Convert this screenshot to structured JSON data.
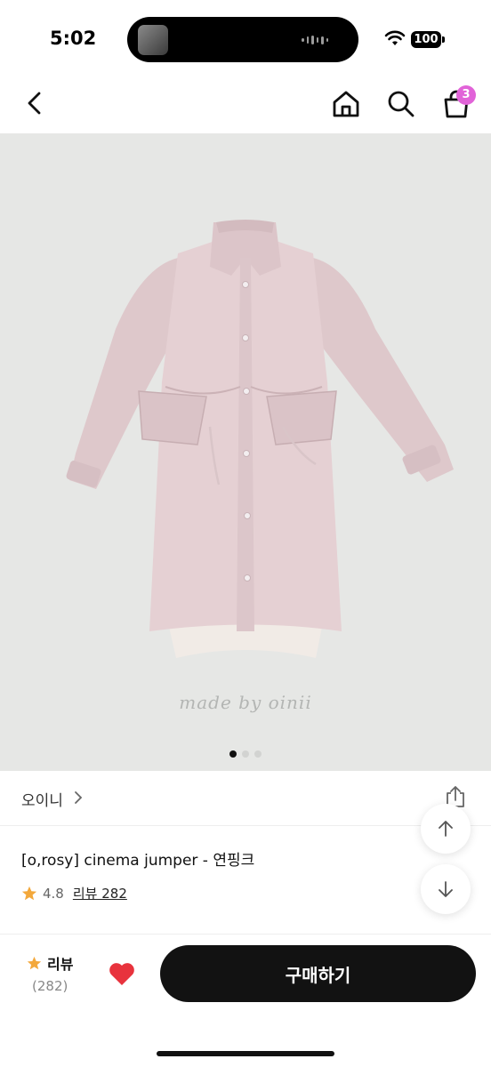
{
  "status_bar": {
    "time": "5:02",
    "battery": "100"
  },
  "nav": {
    "cart_count": "3"
  },
  "hero": {
    "watermark": "made by oinii",
    "slide_count": 3,
    "active_slide": 1
  },
  "product": {
    "brand": "오이니",
    "title": "[o,rosy] cinema jumper - 연핑크",
    "rating": "4.8",
    "review_link": "리뷰 282"
  },
  "bottom_bar": {
    "review_label": "리뷰",
    "review_count": "(282)",
    "buy_label": "구매하기"
  },
  "colors": {
    "accent_badge": "#e163d8",
    "heart": "#e8333d",
    "star": "#f3a83b",
    "buy_button": "#121212",
    "hero_bg": "#e6e7e5",
    "coat": "#e5d0d3"
  },
  "icons": [
    "back-icon",
    "home-icon",
    "search-icon",
    "cart-icon",
    "share-icon",
    "arrow-up-icon",
    "arrow-down-icon",
    "star-icon",
    "heart-icon",
    "wifi-icon"
  ]
}
